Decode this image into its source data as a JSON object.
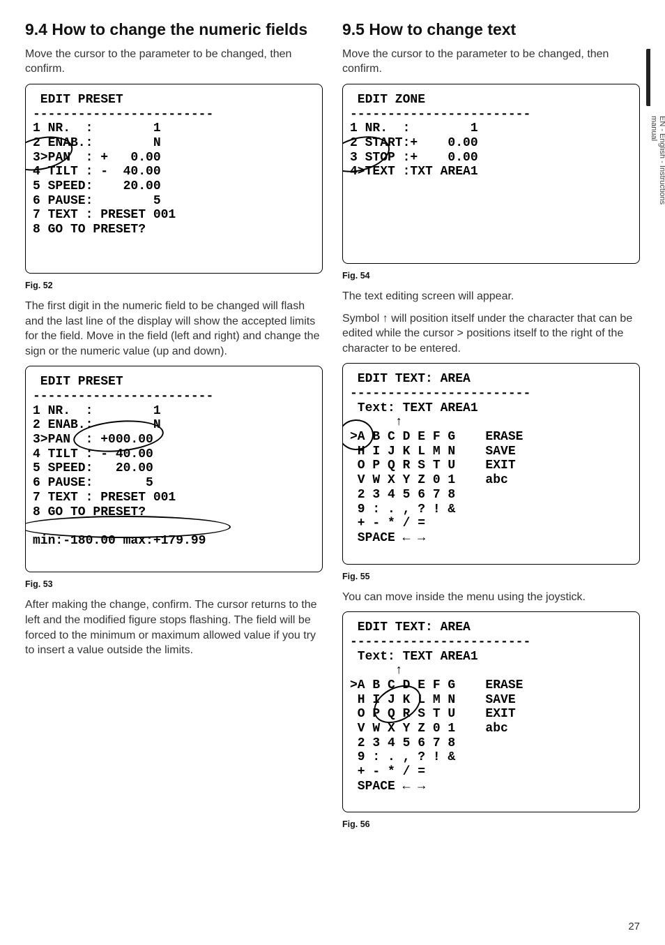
{
  "left": {
    "h1": "9.4  How to change the numeric fields",
    "intro": "Move the cursor to the parameter to be changed, then confirm.",
    "fig52_caption": "Fig. 52",
    "fig52_screen": " EDIT PRESET\n------------------------\n1 NR.  :        1\n2 ENAB.:        N\n3>PAN  : +   0.00\n4 TILT : -  40.00\n5 SPEED:    20.00\n6 PAUSE:        5\n7 TEXT : PRESET 001\n8 GO TO PRESET?",
    "para52": "The first digit in the numeric field to be changed will flash and the last line of the display will show the accepted limits for the field. Move in the field (left and right) and change the sign or the numeric value (up and down).",
    "fig53_caption": "Fig. 53",
    "fig53_screen": " EDIT PRESET\n------------------------\n1 NR.  :        1\n2 ENAB.:        N\n3>PAN  : +000.00\n4 TILT : - 40.00\n5 SPEED:   20.00\n6 PAUSE:       5\n7 TEXT : PRESET 001\n8 GO TO PRESET?\n\nmin:-180.00 max:+179.99",
    "para53": "After making the change, confirm. The cursor returns to the left and the modified figure stops flashing. The field will be forced to the minimum or maximum allowed value if you try to insert a value outside the limits."
  },
  "right": {
    "h1": "9.5  How to change text",
    "intro": "Move the cursor to the parameter to be changed, then confirm.",
    "fig54_caption": "Fig. 54",
    "fig54_screen": " EDIT ZONE\n------------------------\n1 NR.  :        1\n2 START:+    0.00\n3 STOP :+    0.00\n4>TEXT :TXT AREA1",
    "para54a": "The text editing screen will appear.",
    "para54b": "Symbol ↑ will position itself under the character that can be edited while the cursor > positions itself to the right of the character to be entered.",
    "fig55_caption": "Fig. 55",
    "fig55_screen": " EDIT TEXT: AREA\n------------------------\n Text: TEXT AREA1\n      ↑\n>A B C D E F G    ERASE\n H I J K L M N    SAVE\n O P Q R S T U    EXIT\n V W X Y Z 0 1    abc\n 2 3 4 5 6 7 8\n 9 : . , ? ! &\n + - * / =\n SPACE ← →",
    "para55": "You can move inside the menu using the joystick.",
    "fig56_caption": "Fig. 56",
    "fig56_screen": " EDIT TEXT: AREA\n------------------------\n Text: TEXT AREA1\n      ↑\n>A B C D E F G    ERASE\n H I J K L M N    SAVE\n O P Q R S T U    EXIT\n V W X Y Z 0 1    abc\n 2 3 4 5 6 7 8\n 9 : . , ? ! &\n + - * / =\n SPACE ← →"
  },
  "side_label": "EN - English - Instructions manual",
  "page_number": "27"
}
